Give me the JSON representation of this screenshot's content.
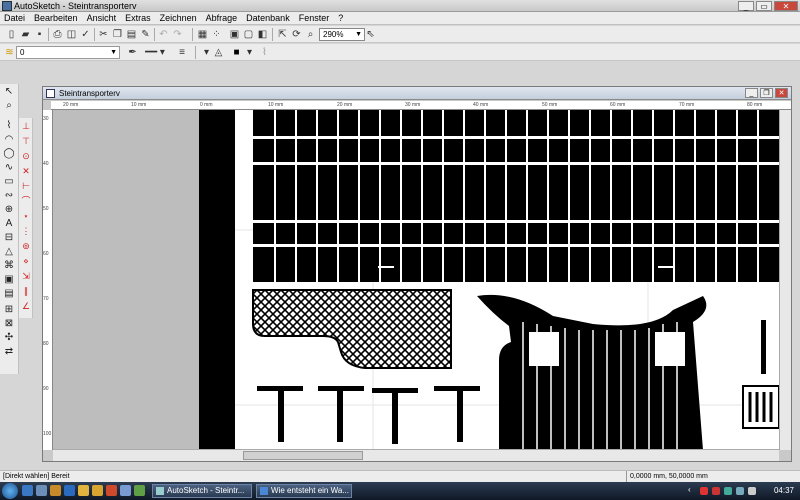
{
  "app": {
    "title": "AutoSketch - Steintransporterv"
  },
  "menu": [
    "Datei",
    "Bearbeiten",
    "Ansicht",
    "Extras",
    "Zeichnen",
    "Abfrage",
    "Datenbank",
    "Fenster",
    "?"
  ],
  "toolbar": {
    "zoom": "290%",
    "layer": "0"
  },
  "document": {
    "title": "Steintransporterv"
  },
  "ruler": {
    "h_ticks": [
      "20 mm",
      "10 mm",
      "0 mm",
      "10 mm",
      "20 mm",
      "30 mm",
      "40 mm",
      "50 mm",
      "60 mm",
      "70 mm",
      "80 mm"
    ],
    "v_ticks": [
      "30",
      "40",
      "50",
      "60",
      "70",
      "80",
      "90",
      "100"
    ]
  },
  "status": {
    "message": "[Direkt wählen] Bereit",
    "coords": "0,0000 mm, 50,0000 mm"
  },
  "taskbar": {
    "tasks": [
      "AutoSketch - Steintr...",
      "Wie entsteht ein Wa..."
    ],
    "clock": "04:37"
  }
}
